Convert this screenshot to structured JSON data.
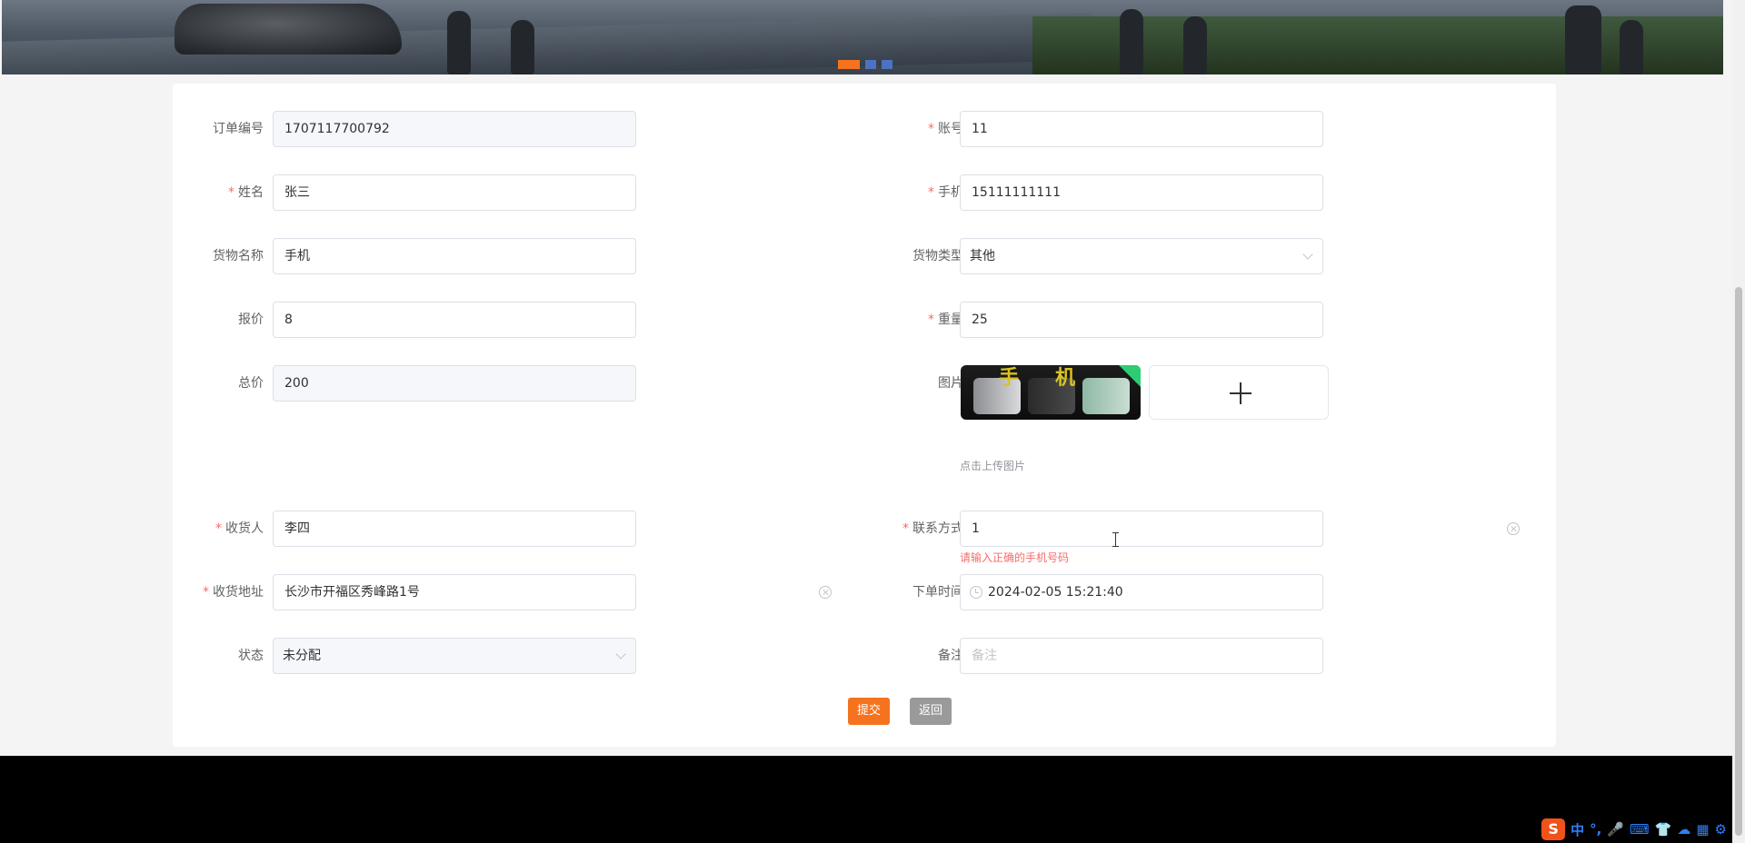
{
  "banner": {
    "slide_count": 3,
    "active_slide": 1
  },
  "form": {
    "order_no": {
      "label": "订单编号",
      "value": "1707117700792"
    },
    "account": {
      "label": "账号",
      "value": "11"
    },
    "name": {
      "label": "姓名",
      "value": "张三"
    },
    "phone": {
      "label": "手机",
      "value": "15111111111"
    },
    "goods_name": {
      "label": "货物名称",
      "value": "手机"
    },
    "goods_type": {
      "label": "货物类型",
      "value": "其他"
    },
    "quote": {
      "label": "报价",
      "value": "8"
    },
    "weight": {
      "label": "重量",
      "value": "25"
    },
    "total": {
      "label": "总价",
      "value": "200"
    },
    "image": {
      "label": "图片",
      "thumb_text": "手机",
      "hint": "点击上传图片"
    },
    "receiver": {
      "label": "收货人",
      "value": "李四"
    },
    "contact": {
      "label": "联系方式",
      "value": "1",
      "error": "请输入正确的手机号码"
    },
    "address": {
      "label": "收货地址",
      "value": "长沙市开福区秀峰路1号"
    },
    "order_time": {
      "label": "下单时间",
      "value": "2024-02-05 15:21:40"
    },
    "status": {
      "label": "状态",
      "value": "未分配"
    },
    "remark": {
      "label": "备注",
      "placeholder": "备注"
    }
  },
  "actions": {
    "submit": "提交",
    "back": "返回"
  },
  "taskbar": {
    "ime_logo": "S",
    "items": [
      "中",
      "°,",
      "🎤",
      "⌨",
      "👕",
      "☁",
      "▦",
      "⚙"
    ]
  },
  "colors": {
    "accent": "#f5731f",
    "error": "#f56c6c",
    "footer": "#000000"
  }
}
